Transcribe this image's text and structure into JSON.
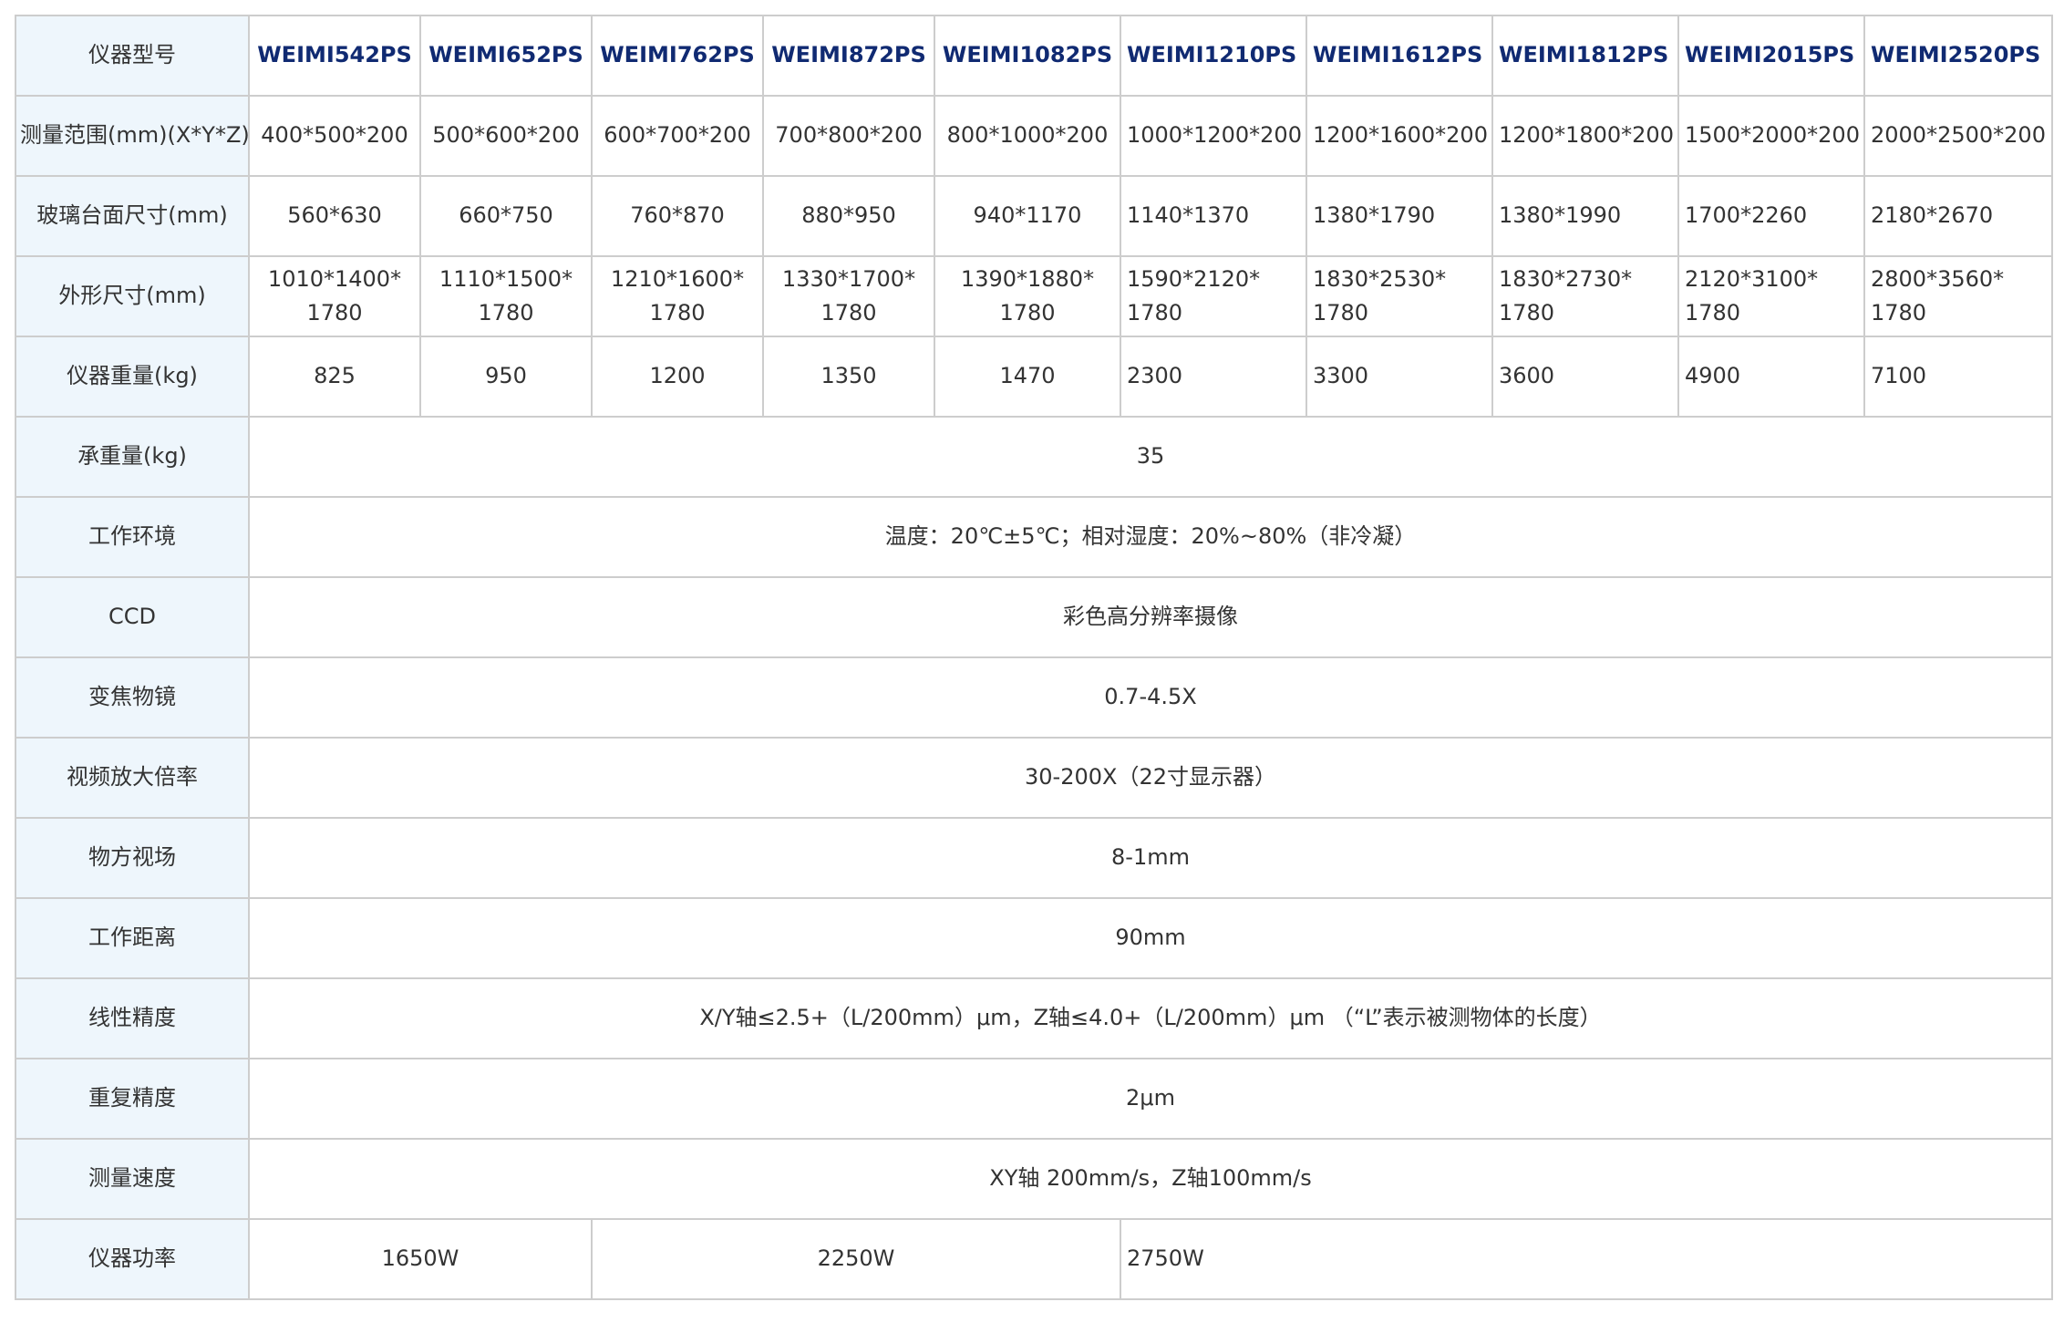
{
  "header_label": "仪器型号",
  "models": [
    "WEIMI542PS",
    "WEIMI652PS",
    "WEIMI762PS",
    "WEIMI872PS",
    "WEIMI1082PS",
    "WEIMI1210PS",
    "WEIMI1612PS",
    "WEIMI1812PS",
    "WEIMI2015PS",
    "WEIMI2520PS"
  ],
  "rows": {
    "range": {
      "label": "测量范围(mm)(X*Y*Z)",
      "values": [
        "400*500*200",
        "500*600*200",
        "600*700*200",
        "700*800*200",
        "800*1000*200",
        "1000*1200*200",
        "1200*1600*200",
        "1200*1800*200",
        "1500*2000*200",
        "2000*2500*200"
      ]
    },
    "glass": {
      "label": "玻璃台面尺寸(mm)",
      "values": [
        "560*630",
        "660*750",
        "760*870",
        "880*950",
        "940*1170",
        "1140*1370",
        "1380*1790",
        "1380*1990",
        "1700*2260",
        "2180*2670"
      ]
    },
    "outline": {
      "label": "外形尺寸(mm)",
      "line1": [
        "1010*1400*",
        "1110*1500*",
        "1210*1600*",
        "1330*1700*",
        "1390*1880*",
        "1590*2120*",
        "1830*2530*",
        "1830*2730*",
        "2120*3100*",
        "2800*3560*"
      ],
      "line2": [
        "1780",
        "1780",
        "1780",
        "1780",
        "1780",
        "1780",
        "1780",
        "1780",
        "1780",
        "1780"
      ]
    },
    "weight": {
      "label": "仪器重量(kg)",
      "values": [
        "825",
        "950",
        "1200",
        "1350",
        "1470",
        "2300",
        "3300",
        "3600",
        "4900",
        "7100"
      ]
    },
    "load": {
      "label": "承重量(kg)",
      "value": "35"
    },
    "env": {
      "label": "工作环境",
      "value": "温度：20℃±5℃；相对湿度：20%~80%（非冷凝）"
    },
    "ccd": {
      "label": "CCD",
      "value": "彩色高分辨率摄像"
    },
    "zoom": {
      "label": "变焦物镜",
      "value": "0.7-4.5X"
    },
    "mag": {
      "label": "视频放大倍率",
      "value": "30-200X（22寸显示器）"
    },
    "fov": {
      "label": "物方视场",
      "value": "8-1mm"
    },
    "wd": {
      "label": "工作距离",
      "value": "90mm"
    },
    "linear": {
      "label": "线性精度",
      "value": "X/Y轴≤2.5+（L/200mm）μm，Z轴≤4.0+（L/200mm）μm （“L”表示被测物体的长度）"
    },
    "repeat": {
      "label": "重复精度",
      "value": "2μm"
    },
    "speed": {
      "label": "测量速度",
      "value": "XY轴 200mm/s，Z轴100mm/s"
    },
    "power": {
      "label": "仪器功率",
      "values": [
        "1650W",
        "2250W",
        "2750W"
      ]
    }
  },
  "colors": {
    "label_bg": "#eef6fc",
    "model_text": "#102a72",
    "border": "#cdcdcd",
    "text": "#333333"
  }
}
